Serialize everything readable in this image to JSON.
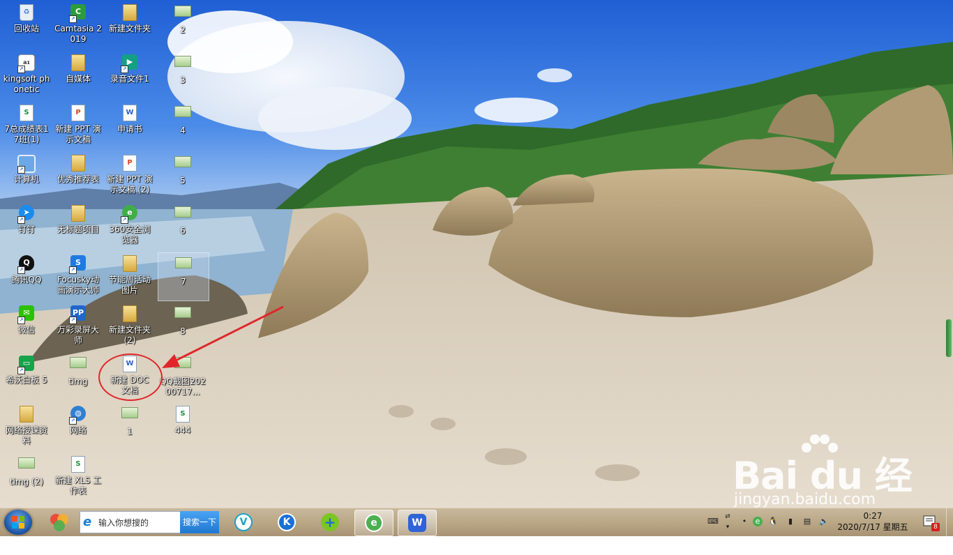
{
  "desktop": {
    "icons": [
      {
        "label": "回收站",
        "glyph": "recycle-bin-icon"
      },
      {
        "label": "Camtasia 2019",
        "glyph": "camtasia-icon"
      },
      {
        "label": "新建文件夹",
        "glyph": "folder-icon"
      },
      {
        "label": "2",
        "glyph": "image-file-icon"
      },
      {
        "label": "kingsoft phonetic",
        "glyph": "kingsoft-phonetic-icon"
      },
      {
        "label": "自媒体",
        "glyph": "folder-icon"
      },
      {
        "label": "录音文件1",
        "glyph": "audio-file-icon"
      },
      {
        "label": "3",
        "glyph": "image-file-icon"
      },
      {
        "label": "7总成绩表17班(1)",
        "glyph": "spreadsheet-icon"
      },
      {
        "label": "新建 PPT 演示文稿",
        "glyph": "ppt-icon"
      },
      {
        "label": "申请书",
        "glyph": "word-doc-icon"
      },
      {
        "label": "4",
        "glyph": "image-file-icon"
      },
      {
        "label": "计算机",
        "glyph": "computer-icon"
      },
      {
        "label": "优秀推荐表",
        "glyph": "folder-icon"
      },
      {
        "label": "新建 PPT 演示文稿 (2)",
        "glyph": "ppt-icon"
      },
      {
        "label": "5",
        "glyph": "image-file-icon"
      },
      {
        "label": "钉钉",
        "glyph": "dingtalk-icon"
      },
      {
        "label": "无标题项目",
        "glyph": "folder-icon"
      },
      {
        "label": "360安全浏览器",
        "glyph": "360-browser-icon"
      },
      {
        "label": "6",
        "glyph": "image-file-icon"
      },
      {
        "label": "腾讯QQ",
        "glyph": "qq-icon"
      },
      {
        "label": "Focusky动画演示大师",
        "glyph": "focusky-icon"
      },
      {
        "label": "节能周活动图片",
        "glyph": "folder-icon"
      },
      {
        "label": "7",
        "glyph": "image-file-icon"
      },
      {
        "label": "微信",
        "glyph": "wechat-icon"
      },
      {
        "label": "万彩录屏大师",
        "glyph": "screen-recorder-icon"
      },
      {
        "label": "新建文件夹 (2)",
        "glyph": "folder-icon"
      },
      {
        "label": "8",
        "glyph": "image-file-icon"
      },
      {
        "label": "希沃白板 5",
        "glyph": "seewo-icon"
      },
      {
        "label": "timg",
        "glyph": "image-file-icon"
      },
      {
        "label": "新建 DOC 文档",
        "glyph": "word-doc-icon"
      },
      {
        "label": "QQ截图20200717...",
        "glyph": "image-file-icon"
      },
      {
        "label": "网络授课资料",
        "glyph": "folder-icon"
      },
      {
        "label": "网络",
        "glyph": "network-icon"
      },
      {
        "label": "1",
        "glyph": "image-file-icon"
      },
      {
        "label": "444",
        "glyph": "spreadsheet-icon"
      },
      {
        "label": "timg (2)",
        "glyph": "image-file-icon"
      },
      {
        "label": "新建 XLS 工作表",
        "glyph": "spreadsheet-icon"
      }
    ],
    "watermark": {
      "brand": "Bai du 经验",
      "url": "jingyan.baidu.com"
    }
  },
  "taskbar": {
    "search": {
      "placeholder": "输入你想搜的",
      "button": "搜索一下"
    },
    "apps": [
      {
        "name": "color-app-icon",
        "color": "#e8a23a"
      },
      {
        "name": "v-app-icon",
        "color": "#1aa3c8",
        "text": "V"
      },
      {
        "name": "k-app-icon",
        "color": "#1b6fd6",
        "text": "K"
      },
      {
        "name": "plus-app-icon",
        "color": "#7cc623",
        "text": "+"
      },
      {
        "name": "360-browser-icon",
        "color": "#4caf50",
        "text": "e"
      },
      {
        "name": "wps-icon",
        "color": "#2f63d8",
        "text": "W"
      }
    ],
    "clock": {
      "time": "0:27",
      "date": "2020/7/17 星期五"
    },
    "notification_count": "8"
  }
}
